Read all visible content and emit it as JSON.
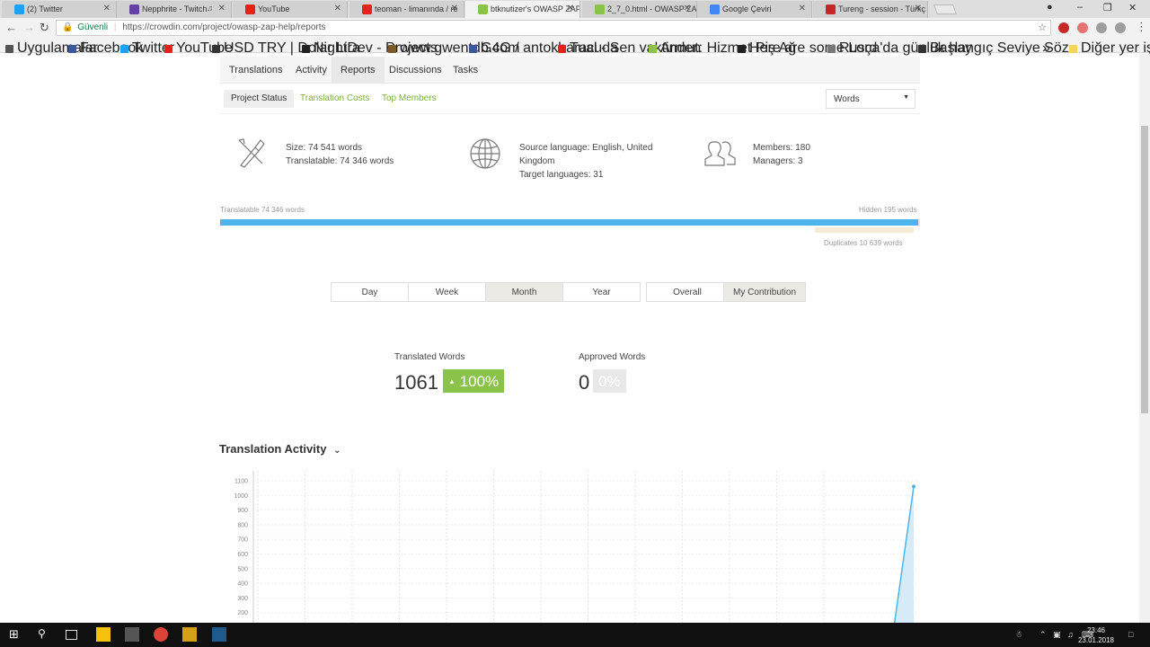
{
  "browser": {
    "tabs": [
      {
        "title": "(2) Twitter",
        "icon_color": "#1da1f2"
      },
      {
        "title": "Nepphrite - Twitch",
        "icon_color": "#6441a4",
        "audio": true
      },
      {
        "title": "YouTube",
        "icon_color": "#e62117"
      },
      {
        "title": "teoman - limanında / re",
        "icon_color": "#e62117"
      },
      {
        "title": "btknutizer's OWASP ZAP",
        "icon_color": "#8bc34a",
        "active": true
      },
      {
        "title": "2_7_0.html - OWASP ZA",
        "icon_color": "#8bc34a"
      },
      {
        "title": "Google Çeviri",
        "icon_color": "#4285f4"
      },
      {
        "title": "Tureng - session - Türkç",
        "icon_color": "#c62828"
      }
    ],
    "secure_label": "Güvenli",
    "url": "https://crowdin.com/project/owasp-zap-help/reports",
    "bookmarks": [
      {
        "label": "Uygulamalar",
        "icon_color": "#555"
      },
      {
        "label": "Facebook",
        "icon_color": "#3b5998"
      },
      {
        "label": "Twitter",
        "icon_color": "#1da1f2"
      },
      {
        "label": "YouTube",
        "icon_color": "#e62117"
      },
      {
        "label": "USD TRY | Dolar Lira",
        "icon_color": "#333"
      },
      {
        "label": "NightDev - Projects",
        "icon_color": "#222"
      },
      {
        "label": "www.gwentdb.com",
        "icon_color": "#7a5a2a"
      },
      {
        "label": "G4G / antokbaracuda",
        "icon_color": "#3b5998"
      },
      {
        "label": "Tual - Sen vaktinden",
        "icon_color": "#e62117"
      },
      {
        "label": "Armut: Hizmet Piş Ağ",
        "icon_color": "#8bc34a"
      },
      {
        "label": "Here are some Lord",
        "icon_color": "#222"
      },
      {
        "label": "Rusça'da günlük hay",
        "icon_color": "#777"
      },
      {
        "label": "Başlangıç Seviye Söz",
        "icon_color": "#333"
      }
    ],
    "other_bookmarks": "Diğer yer işaretleri"
  },
  "page": {
    "nav_tabs": [
      "Translations",
      "Activity",
      "Reports",
      "Discussions",
      "Tasks"
    ],
    "active_nav": "Reports",
    "sub_tabs": [
      "Project Status",
      "Translation Costs",
      "Top Members"
    ],
    "active_sub": "Project Status",
    "units_select": "Words",
    "size_line": "Size: 74 541 words",
    "translatable_line": "Translatable: 74 346 words",
    "source_language": "Source language: English, United",
    "source_language_cont": "Kingdom",
    "target_languages": "Target languages: 31",
    "members": "Members: 180",
    "managers": "Managers: 3",
    "translatable_label": "Translatable 74 346 words",
    "hidden_label": "Hidden 195 words",
    "duplicates_label": "Duplicates 10 639 words",
    "translatable_fraction": 0.997,
    "period_buttons": [
      "Day",
      "Week",
      "Month",
      "Year"
    ],
    "active_period": "Month",
    "scope_buttons": [
      "Overall",
      "My Contribution"
    ],
    "active_scope": "My Contribution",
    "translated_label": "Translated Words",
    "translated_value": "1061",
    "translated_pct": "100%",
    "approved_label": "Approved Words",
    "approved_value": "0",
    "approved_pct": "0%",
    "activity_title": "Translation Activity",
    "colors": {
      "accent_green": "#8bc34a",
      "progress_blue": "#4db4ec",
      "link_green": "#7cae3c"
    }
  },
  "chart_data": {
    "type": "area",
    "title": "Translation Activity",
    "y_ticks": [
      200,
      300,
      400,
      500,
      600,
      700,
      800,
      900,
      1000,
      1100
    ],
    "ylim": [
      0,
      1100
    ],
    "series": [
      {
        "values": [
          0,
          0,
          0,
          0,
          0,
          0,
          0,
          0,
          0,
          0,
          0,
          0,
          0,
          0,
          0,
          0,
          0,
          0,
          0,
          0,
          0,
          0,
          0,
          0,
          0,
          0,
          0,
          0,
          0,
          0,
          1061
        ]
      }
    ],
    "grid": true
  },
  "taskbar": {
    "date": "23.01.2018",
    "time": "23:46"
  }
}
